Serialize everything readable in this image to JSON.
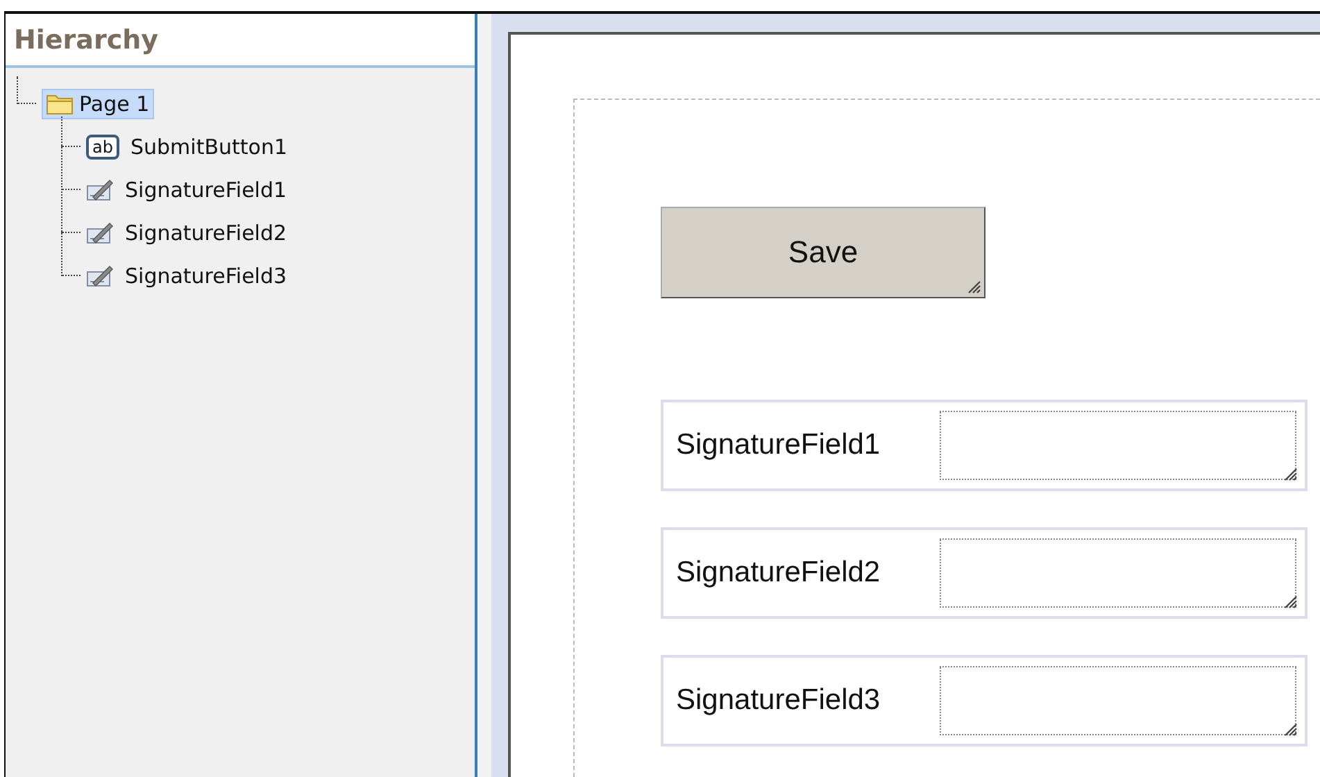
{
  "hierarchy": {
    "title": "Hierarchy",
    "tree": [
      {
        "label": "Page 1",
        "kind": "page",
        "selected": true,
        "children": [
          {
            "label": "SubmitButton1",
            "kind": "button",
            "icon_label": "ab",
            "selected": false
          },
          {
            "label": "SignatureField1",
            "kind": "signature",
            "selected": false
          },
          {
            "label": "SignatureField2",
            "kind": "signature",
            "selected": false
          },
          {
            "label": "SignatureField3",
            "kind": "signature",
            "selected": false
          }
        ]
      }
    ]
  },
  "canvas": {
    "controls": [
      {
        "kind": "button",
        "label": "Save"
      },
      {
        "kind": "signature",
        "label": "SignatureField1"
      },
      {
        "kind": "signature",
        "label": "SignatureField2"
      },
      {
        "kind": "signature",
        "label": "SignatureField3"
      }
    ]
  }
}
